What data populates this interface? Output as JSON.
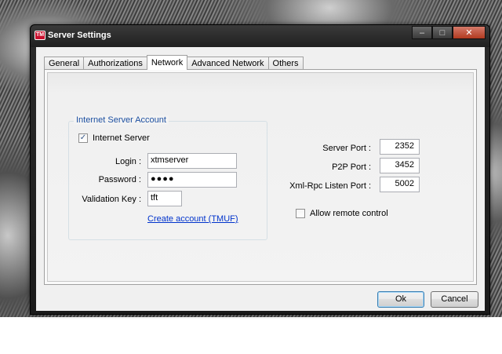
{
  "window": {
    "title": "Server Settings",
    "app_icon_label": "TM"
  },
  "titlebar_buttons": {
    "minimize": "–",
    "maximize": "□",
    "close": "✕"
  },
  "tabs": [
    {
      "label": "General",
      "active": false
    },
    {
      "label": "Authorizations",
      "active": false
    },
    {
      "label": "Network",
      "active": true
    },
    {
      "label": "Advanced Network",
      "active": false
    },
    {
      "label": "Others",
      "active": false
    }
  ],
  "account": {
    "group_title": "Internet Server Account",
    "internet_server_label": "Internet Server",
    "internet_server_checked": true,
    "check_glyph": "✓",
    "login_label": "Login :",
    "login_value": "xtmserver",
    "password_label": "Password :",
    "password_value": "●●●●",
    "validation_label": "Validation Key :",
    "validation_value": "tft",
    "create_link": "Create account (TMUF)"
  },
  "ports": {
    "server_port_label": "Server Port :",
    "server_port_value": "2352",
    "p2p_port_label": "P2P Port :",
    "p2p_port_value": "3452",
    "xmlrpc_port_label": "Xml-Rpc Listen Port :",
    "xmlrpc_port_value": "5002",
    "remote_control_label": "Allow remote control",
    "remote_control_checked": false
  },
  "buttons": {
    "ok": "Ok",
    "cancel": "Cancel"
  },
  "colors": {
    "group_title": "#1c4fa0",
    "link": "#0033cc",
    "close_button": "#b23a20"
  }
}
